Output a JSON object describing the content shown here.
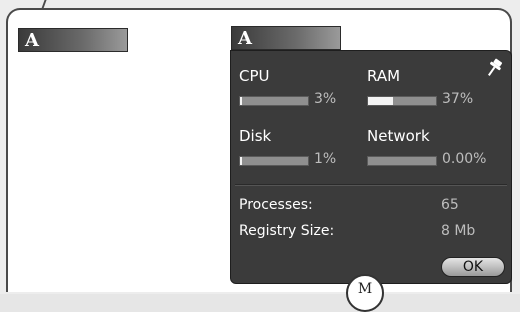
{
  "tabs": {
    "left_letter": "A",
    "right_letter": "A"
  },
  "stats": {
    "cpu": {
      "label": "CPU",
      "value_text": "3%",
      "fill": 0.03
    },
    "ram": {
      "label": "RAM",
      "value_text": "37%",
      "fill": 0.37
    },
    "disk": {
      "label": "Disk",
      "value_text": "1%",
      "fill": 0.01
    },
    "network": {
      "label": "Network",
      "value_text": "0.00%",
      "fill": 0.0
    }
  },
  "info": {
    "processes_label": "Processes:",
    "processes_value": "65",
    "registry_label": "Registry Size:",
    "registry_value": "8 Mb"
  },
  "ok_label": "OK",
  "callout_letter": "M",
  "icons": {
    "pin": "pin-icon"
  },
  "colors": {
    "panel_bg": "#3b3b3b",
    "bar_track": "#8f8f8f",
    "bar_fill": "#f4f4f4"
  }
}
